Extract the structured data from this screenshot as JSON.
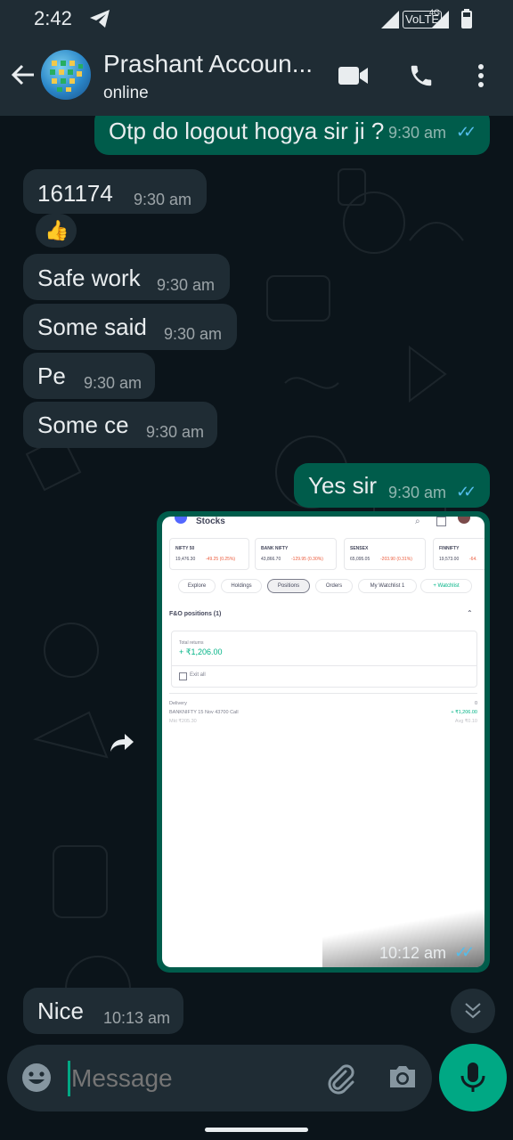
{
  "status_bar": {
    "time": "2:42",
    "network": "VoLTE",
    "network_gen": "4G"
  },
  "header": {
    "contact_name": "Prashant Accoun...",
    "status": "online"
  },
  "messages": [
    {
      "direction": "out",
      "text": "Otp do logout hogya sir ji ?",
      "time": "9:30 am",
      "ticks": "✓✓"
    },
    {
      "direction": "in",
      "text": "161174",
      "time": "9:30 am"
    },
    {
      "direction": "in",
      "emoji": "👍"
    },
    {
      "direction": "in",
      "text": "Safe work",
      "time": "9:30 am"
    },
    {
      "direction": "in",
      "text": "Some said",
      "time": "9:30 am"
    },
    {
      "direction": "in",
      "text": "Pe",
      "time": "9:30 am"
    },
    {
      "direction": "in",
      "text": "Some ce",
      "time": "9:30 am"
    },
    {
      "direction": "out",
      "text": "Yes sir",
      "time": "9:30 am",
      "ticks": "✓✓"
    },
    {
      "direction": "out",
      "type": "image",
      "time": "10:12 am",
      "ticks": "✓✓"
    },
    {
      "direction": "in",
      "text": "Nice",
      "time": "10:13 am"
    }
  ],
  "screenshot": {
    "title": "Stocks",
    "indices": [
      {
        "name": "NIFTY 50",
        "value": "19,476.30",
        "change": "-49.25 (0.25%)"
      },
      {
        "name": "BANK NIFTY",
        "value": "43,866.70",
        "change": "-129.95 (0.30%)"
      },
      {
        "name": "SENSEX",
        "value": "65,095.05",
        "change": "-203.90 (0.31%)"
      },
      {
        "name": "FINNIFTY",
        "value": "19,573.00",
        "change": "-64."
      }
    ],
    "tabs": [
      "Explore",
      "Holdings",
      "Positions",
      "Orders",
      "My Watchlist 1",
      "+ Watchlist"
    ],
    "section_title": "F&O positions (1)",
    "returns_label": "Total returns",
    "returns_value": "+ ₹1,206.00",
    "exit_label": "Exit all",
    "position_type": "Delivery",
    "position_qty": "0",
    "position_name": "BANKNIFTY 15 Nov 43700 Call",
    "position_pnl": "+ ₹1,206.00",
    "position_ltp": "Mkt ₹205.30",
    "position_avg": "Avg ₹0.10"
  },
  "composer": {
    "placeholder": "Message"
  },
  "colors": {
    "incoming": "#1f2c34",
    "outgoing": "#005c4b",
    "accent": "#00a884",
    "read_ticks": "#53bdeb"
  }
}
